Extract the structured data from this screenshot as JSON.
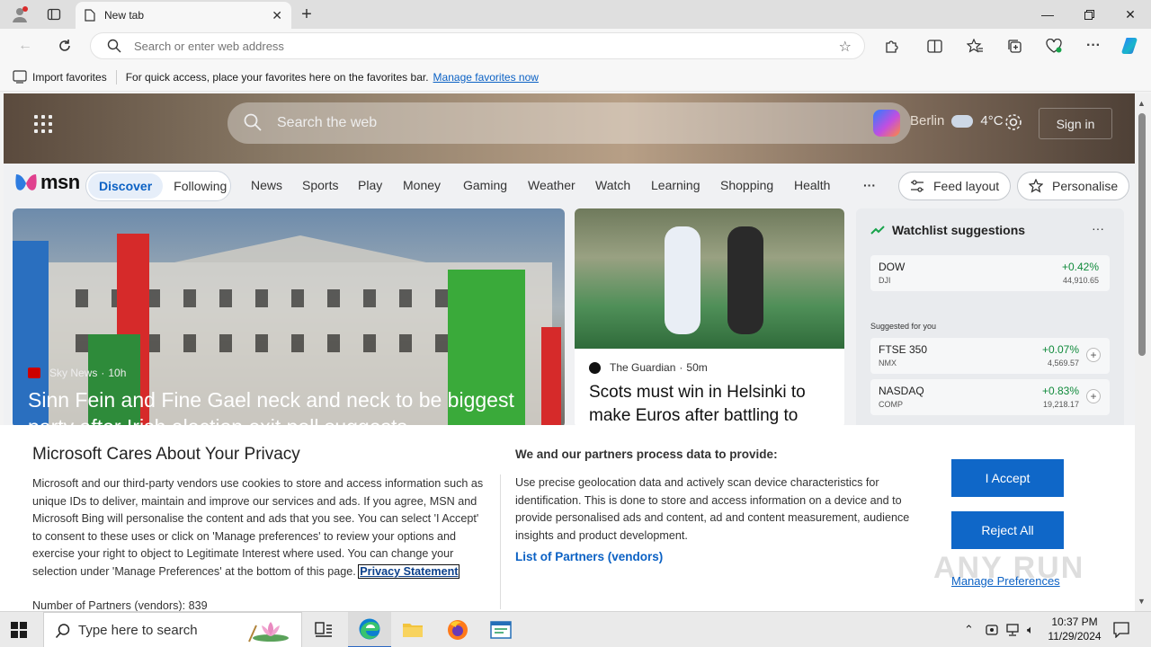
{
  "browser": {
    "tab_title": "New tab",
    "address_placeholder": "Search or enter web address",
    "favorites": {
      "import_label": "Import favorites",
      "hint": "For quick access, place your favorites here on the favorites bar.",
      "manage_link": "Manage favorites now"
    }
  },
  "msn": {
    "search_placeholder": "Search the web",
    "city": "Berlin",
    "temperature": "4°C",
    "signin": "Sign in",
    "logo_text": "msn",
    "pills": [
      "Discover",
      "Following"
    ],
    "nav": [
      "News",
      "Sports",
      "Play",
      "Money",
      "Gaming",
      "Weather",
      "Watch",
      "Learning",
      "Shopping",
      "Health"
    ],
    "more": "···",
    "feed_layout": "Feed layout",
    "personalise": "Personalise"
  },
  "hero": {
    "source": "Sky News",
    "age": "10h",
    "title": "Sinn Fein and Fine Gael neck and neck to be biggest party after Irish election exit poll suggests"
  },
  "news": {
    "source": "The Guardian",
    "age": "50m",
    "title": "Scots must win in Helsinki to make Euros after battling to"
  },
  "watchlist": {
    "title": "Watchlist suggestions",
    "more": "···",
    "suggested_label": "Suggested for you",
    "top": {
      "symbol": "DOW",
      "sub": "DJI",
      "change": "+0.42%",
      "value": "44,910.65"
    },
    "suggested": [
      {
        "symbol": "FTSE 350",
        "sub": "NMX",
        "change": "+0.07%",
        "value": "4,569.57"
      },
      {
        "symbol": "NASDAQ",
        "sub": "COMP",
        "change": "+0.83%",
        "value": "19,218.17"
      }
    ]
  },
  "privacy": {
    "title": "Microsoft Cares About Your Privacy",
    "body": "Microsoft and our third-party vendors use cookies to store and access information such as unique IDs to deliver, maintain and improve our services and ads. If you agree, MSN and Microsoft Bing will personalise the content and ads that you see. You can select 'I Accept' to consent to these uses or click on 'Manage preferences' to review your options and exercise your right to object to Legitimate Interest where used.  You can change your selection under 'Manage Preferences' at the bottom of this page.",
    "privacy_link": "Privacy Statement",
    "partners": "Number of Partners (vendors): 839",
    "heading2": "We and our partners process data to provide:",
    "body2": "Use precise geolocation data and actively scan device characteristics for identification. This is done to store and access information on a device and to provide personalised ads and content, ad and content measurement, audience insights and product development.",
    "vendors_link": "List of Partners (vendors)",
    "accept": "I Accept",
    "reject": "Reject All",
    "manage": "Manage Preferences"
  },
  "watermark": "ANY RUN",
  "taskbar": {
    "search_placeholder": "Type here to search",
    "time": "10:37 PM",
    "date": "11/29/2024"
  },
  "colors": {
    "accent": "#0f67c8",
    "link": "#0b61c4",
    "positive": "#108a3b"
  }
}
